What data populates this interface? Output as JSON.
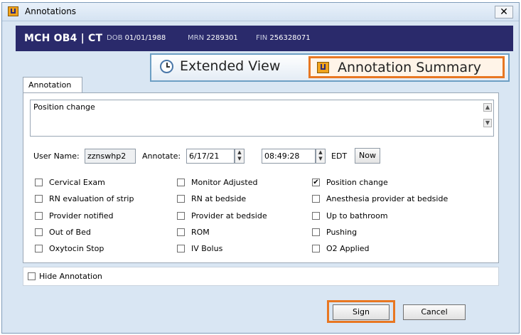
{
  "window": {
    "title": "Annotations",
    "close_glyph": "✕"
  },
  "patient": {
    "name": "MCH OB4 | CT",
    "dob_label": "DOB",
    "dob": "01/01/1988",
    "mrn_label": "MRN",
    "mrn": "2289301",
    "fin_label": "FIN",
    "fin": "256328071"
  },
  "popup": {
    "extended_view": "Extended View",
    "annotation_summary": "Annotation Summary"
  },
  "tab": {
    "label": "Annotation"
  },
  "annotation_text": "Position change",
  "scroll": {
    "up": "▲",
    "down": "▼"
  },
  "user": {
    "label": "User Name:",
    "value": "zznswhp2"
  },
  "annotate": {
    "label": "Annotate:",
    "date": "6/17/21",
    "time": "08:49:28",
    "tz": "EDT",
    "now_button": "Now",
    "spin_up": "▲",
    "spin_down": "▼"
  },
  "checkboxes": [
    {
      "label": "Cervical Exam",
      "checked": false
    },
    {
      "label": "Monitor Adjusted",
      "checked": false
    },
    {
      "label": "Position change",
      "checked": true
    },
    {
      "label": "RN evaluation of strip",
      "checked": false
    },
    {
      "label": "RN at bedside",
      "checked": false
    },
    {
      "label": "Anesthesia provider at bedside",
      "checked": false
    },
    {
      "label": "Provider notified",
      "checked": false
    },
    {
      "label": "Provider at bedside",
      "checked": false
    },
    {
      "label": "Up to bathroom",
      "checked": false
    },
    {
      "label": "Out of Bed",
      "checked": false
    },
    {
      "label": "ROM",
      "checked": false
    },
    {
      "label": "Pushing",
      "checked": false
    },
    {
      "label": "Oxytocin Stop",
      "checked": false
    },
    {
      "label": "IV Bolus",
      "checked": false
    },
    {
      "label": "O2 Applied",
      "checked": false
    }
  ],
  "check_glyph": "✔",
  "hide_annotation": {
    "label": "Hide Annotation",
    "checked": false
  },
  "buttons": {
    "sign": "Sign",
    "cancel": "Cancel"
  },
  "colors": {
    "banner": "#2a2a6b",
    "highlight": "#e87722",
    "window_bg": "#d9e6f3"
  }
}
